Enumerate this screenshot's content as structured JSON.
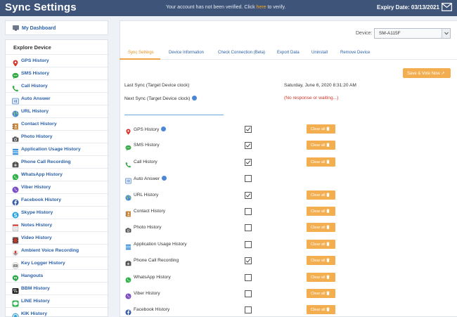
{
  "header": {
    "title": "Sync Settings",
    "notice_prefix": "Your account has not been verified.  Click ",
    "notice_link": "here",
    "notice_suffix": " to verify.",
    "expiry": "Expiry Date: 03/13/2021"
  },
  "sidebar": {
    "dashboard": "My Dashboard",
    "section_title": "Explore Device",
    "items": [
      {
        "label": "GPS History",
        "icon": "map-pin-icon",
        "color": "#d9342b"
      },
      {
        "label": "SMS History",
        "icon": "chat-bubble-icon",
        "color": "#35a845"
      },
      {
        "label": "Call History",
        "icon": "phone-icon",
        "color": "#35a845"
      },
      {
        "label": "Auto Answer",
        "icon": "auto-answer-icon",
        "color": "#5b8fd4"
      },
      {
        "label": "URL History",
        "icon": "globe-icon",
        "color": "#4b87d4"
      },
      {
        "label": "Contact History",
        "icon": "contact-book-icon",
        "color": "#c8873a"
      },
      {
        "label": "Photo History",
        "icon": "camera-icon",
        "color": "#555555"
      },
      {
        "label": "Application Usage History",
        "icon": "app-stack-icon",
        "color": "#3b8fd8"
      },
      {
        "label": "Phone Call Recording",
        "icon": "call-recorder-icon",
        "color": "#555555"
      },
      {
        "label": "WhatsApp History",
        "icon": "whatsapp-icon",
        "color": "#2fb14a"
      },
      {
        "label": "Viber History",
        "icon": "viber-icon",
        "color": "#7b4fc2"
      },
      {
        "label": "Facebook History",
        "icon": "facebook-icon",
        "color": "#3b5ea8"
      },
      {
        "label": "Skype History",
        "icon": "skype-icon",
        "color": "#1fa0e0"
      },
      {
        "label": "Notes History",
        "icon": "notes-icon",
        "color": "#d9342b"
      },
      {
        "label": "Video History",
        "icon": "video-icon",
        "color": "#c0392b"
      },
      {
        "label": "Ambient Voice Recording",
        "icon": "microphone-icon",
        "color": "#d9342b"
      },
      {
        "label": "Key Logger History",
        "icon": "keyboard-icon",
        "color": "#555555"
      },
      {
        "label": "Hangouts",
        "icon": "hangouts-icon",
        "color": "#2fa84f"
      },
      {
        "label": "BBM History",
        "icon": "bbm-icon",
        "color": "#222222"
      },
      {
        "label": "LINE History",
        "icon": "line-icon",
        "color": "#2fb14a"
      },
      {
        "label": "KIK History",
        "icon": "kik-icon",
        "color": "#3aa0d8"
      }
    ]
  },
  "device": {
    "label": "Device:",
    "selected": "SM-A115F"
  },
  "tabs": [
    {
      "label": "Sync Settings",
      "active": true
    },
    {
      "label": "Device Information",
      "active": false
    },
    {
      "label": "Check Connection (Beta)",
      "active": false
    },
    {
      "label": "Export Data",
      "active": false
    },
    {
      "label": "Uninstall",
      "active": false
    },
    {
      "label": "Remove Device",
      "active": false
    }
  ],
  "save_button": "Save & Vote Now",
  "sync_info": {
    "last_sync_label": "Last Sync (Target Device clock)",
    "last_sync_value": "Saturday, June 6, 2020 8:31:20 AM",
    "next_sync_label": "Next Sync (Target Device clock)",
    "next_sync_value": "(No response or waiting...)"
  },
  "clear_label": "Clear all",
  "settings": [
    {
      "label": "GPS History",
      "icon": "map-pin-icon",
      "color": "#d9342b",
      "help": true,
      "checked": true,
      "clear": true
    },
    {
      "label": "SMS History",
      "icon": "chat-bubble-icon",
      "color": "#35a845",
      "help": false,
      "checked": true,
      "clear": true
    },
    {
      "label": "Call History",
      "icon": "phone-icon",
      "color": "#35a845",
      "help": false,
      "checked": true,
      "clear": true
    },
    {
      "label": "Auto Answer",
      "icon": "auto-answer-icon",
      "color": "#5b8fd4",
      "help": true,
      "checked": false,
      "clear": false
    },
    {
      "label": "URL History",
      "icon": "globe-icon",
      "color": "#4b87d4",
      "help": false,
      "checked": true,
      "clear": true
    },
    {
      "label": "Contact History",
      "icon": "contact-book-icon",
      "color": "#c8873a",
      "help": false,
      "checked": false,
      "clear": true
    },
    {
      "label": "Photo History",
      "icon": "camera-icon",
      "color": "#555555",
      "help": false,
      "checked": false,
      "clear": true
    },
    {
      "label": "Application Usage History",
      "icon": "app-stack-icon",
      "color": "#3b8fd8",
      "help": false,
      "checked": false,
      "clear": true
    },
    {
      "label": "Phone Call Recording",
      "icon": "call-recorder-icon",
      "color": "#555555",
      "help": false,
      "checked": true,
      "clear": true
    },
    {
      "label": "WhatsApp History",
      "icon": "whatsapp-icon",
      "color": "#2fb14a",
      "help": false,
      "checked": false,
      "clear": true
    },
    {
      "label": "Viber History",
      "icon": "viber-icon",
      "color": "#7b4fc2",
      "help": false,
      "checked": false,
      "clear": true
    },
    {
      "label": "Facebook History",
      "icon": "facebook-icon",
      "color": "#3b5ea8",
      "help": false,
      "checked": false,
      "clear": true
    }
  ],
  "colors": {
    "header_bg": "#3f5479",
    "link_blue": "#2a5fa8",
    "accent_orange": "#f2ae4f",
    "error_red": "#d2352a"
  }
}
